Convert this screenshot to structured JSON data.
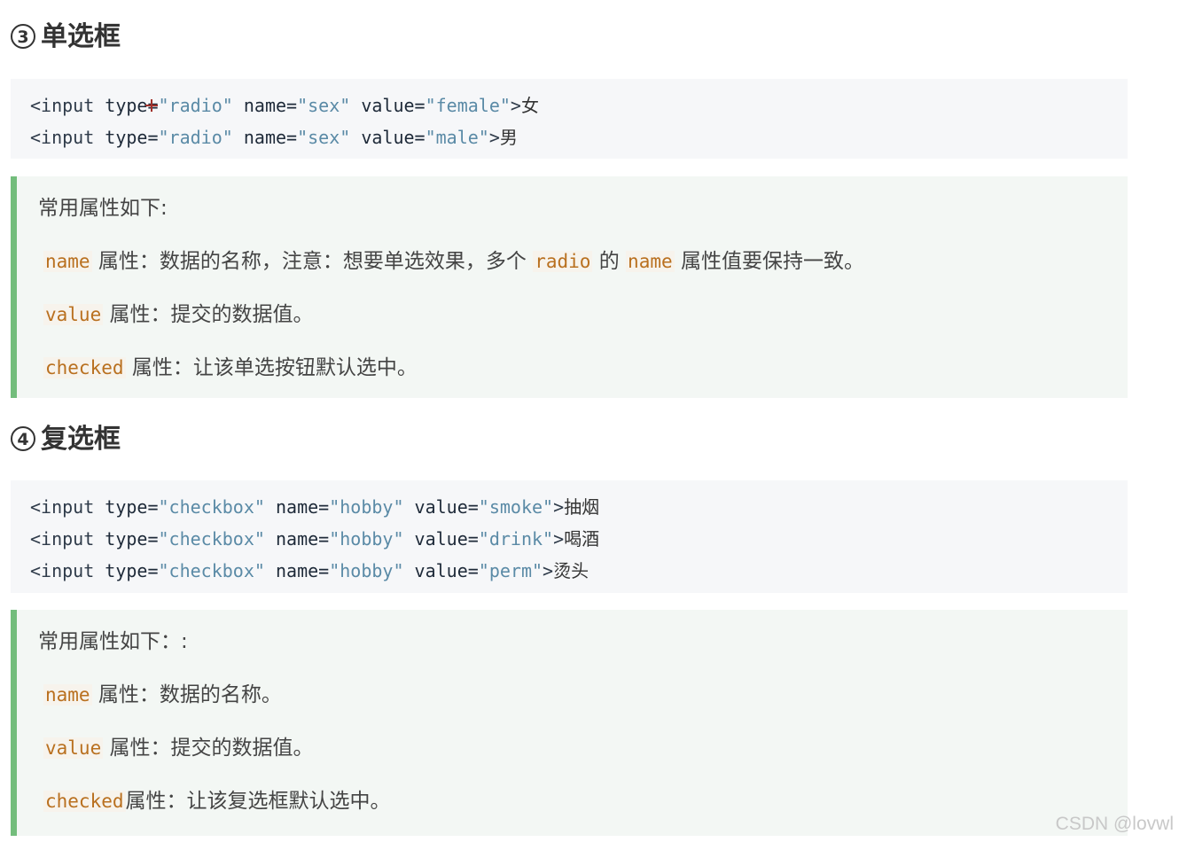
{
  "radio_section": {
    "number": "3",
    "title": "单选框",
    "code_lines": [
      {
        "tag": "<input",
        "type_attr": "type=",
        "type_val": "\"radio\"",
        "name_attr": "name=",
        "name_val": "\"sex\"",
        "value_attr": "value=",
        "value_val": "\"female\"",
        "close": ">",
        "text": "女"
      },
      {
        "tag": "<input",
        "type_attr": "type=",
        "type_val": "\"radio\"",
        "name_attr": "name=",
        "name_val": "\"sex\"",
        "value_attr": "value=",
        "value_val": "\"male\"",
        "close": ">",
        "text": "男"
      }
    ],
    "note_intro": "常用属性如下:",
    "notes": {
      "name_kw": "name",
      "name_text_1": "属性：数据的名称，注意：想要单选效果，多个",
      "name_kw2": "radio",
      "name_text_2": "的",
      "name_kw3": "name",
      "name_text_3": "属性值要保持一致。",
      "value_kw": "value",
      "value_text": "属性：提交的数据值。",
      "checked_kw": "checked",
      "checked_text": "属性：让该单选按钮默认选中。"
    }
  },
  "checkbox_section": {
    "number": "4",
    "title": "复选框",
    "code_lines": [
      {
        "tag": "<input",
        "type_attr": "type=",
        "type_val": "\"checkbox\"",
        "name_attr": "name=",
        "name_val": "\"hobby\"",
        "value_attr": "value=",
        "value_val": "\"smoke\"",
        "close": ">",
        "text": "抽烟"
      },
      {
        "tag": "<input",
        "type_attr": "type=",
        "type_val": "\"checkbox\"",
        "name_attr": "name=",
        "name_val": "\"hobby\"",
        "value_attr": "value=",
        "value_val": "\"drink\"",
        "close": ">",
        "text": "喝酒"
      },
      {
        "tag": "<input",
        "type_attr": "type=",
        "type_val": "\"checkbox\"",
        "name_attr": "name=",
        "name_val": "\"hobby\"",
        "value_attr": "value=",
        "value_val": "\"perm\"",
        "close": ">",
        "text": "烫头"
      }
    ],
    "note_intro": "常用属性如下：:",
    "notes": {
      "name_kw": "name",
      "name_text": "属性：数据的名称。",
      "value_kw": "value",
      "value_text": "属性：提交的数据值。",
      "checked_kw": "checked",
      "checked_text": "属性：让该复选框默认选中。"
    }
  },
  "watermark": "CSDN @lovwl"
}
